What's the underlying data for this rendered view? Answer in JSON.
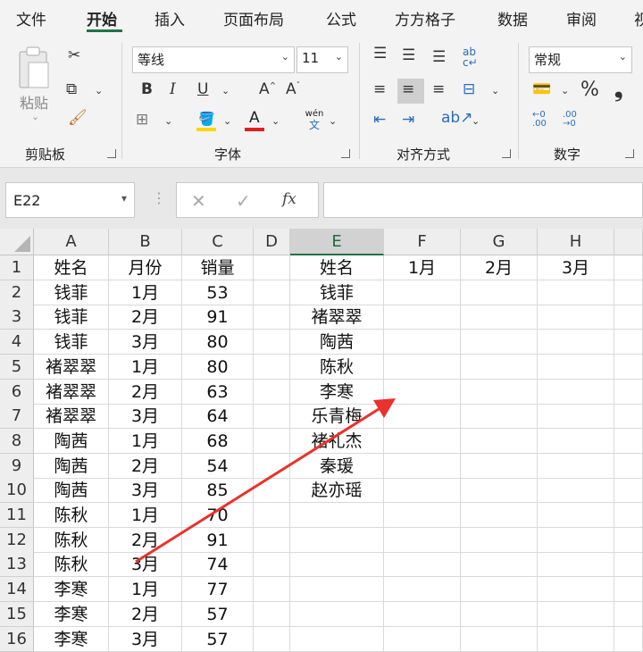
{
  "tabs": [
    "文件",
    "开始",
    "插入",
    "页面布局",
    "公式",
    "方方格子",
    "数据",
    "审阅",
    "视"
  ],
  "clipboard": {
    "paste_label": "粘贴",
    "group_label": "剪贴板"
  },
  "font": {
    "name": "等线",
    "size": "11",
    "group_label": "字体"
  },
  "alignment": {
    "group_label": "对齐方式"
  },
  "number": {
    "format": "常规",
    "group_label": "数字"
  },
  "formula_bar": {
    "name_box": "E22",
    "formula": ""
  },
  "columns": [
    "A",
    "B",
    "C",
    "D",
    "E",
    "F",
    "G",
    "H"
  ],
  "rows": [
    "1",
    "2",
    "3",
    "4",
    "5",
    "6",
    "7",
    "8",
    "9",
    "10",
    "11",
    "12",
    "13",
    "14",
    "15",
    "16"
  ],
  "table_a": [
    [
      "姓名",
      "月份",
      "销量"
    ],
    [
      "钱菲",
      "1月",
      "53"
    ],
    [
      "钱菲",
      "2月",
      "91"
    ],
    [
      "钱菲",
      "3月",
      "80"
    ],
    [
      "褚翠翠",
      "1月",
      "80"
    ],
    [
      "褚翠翠",
      "2月",
      "63"
    ],
    [
      "褚翠翠",
      "3月",
      "64"
    ],
    [
      "陶茜",
      "1月",
      "68"
    ],
    [
      "陶茜",
      "2月",
      "54"
    ],
    [
      "陶茜",
      "3月",
      "85"
    ],
    [
      "陈秋",
      "1月",
      "70"
    ],
    [
      "陈秋",
      "2月",
      "91"
    ],
    [
      "陈秋",
      "3月",
      "74"
    ],
    [
      "李寒",
      "1月",
      "77"
    ],
    [
      "李寒",
      "2月",
      "57"
    ],
    [
      "李寒",
      "3月",
      "57"
    ]
  ],
  "table_e": {
    "header": [
      "姓名",
      "1月",
      "2月",
      "3月"
    ],
    "names": [
      "钱菲",
      "褚翠翠",
      "陶茜",
      "陈秋",
      "李寒",
      "乐青梅",
      "褚礼杰",
      "秦瑗",
      "赵亦瑶"
    ]
  },
  "colors": {
    "accent": "#217346",
    "arrow": "#e8322b",
    "font_underline": "#e02020",
    "fill_underline": "#ffd700"
  }
}
